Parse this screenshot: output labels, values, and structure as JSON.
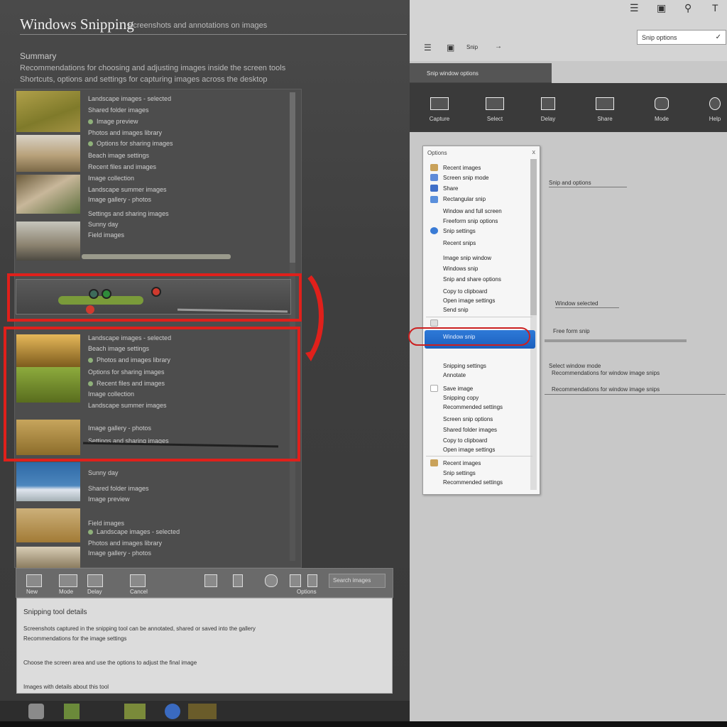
{
  "left": {
    "title": "Windows Snipping",
    "title_rest": "Screenshots and annotations on images",
    "summary_label": "Summary",
    "summary_line_1": "Recommendations for choosing and adjusting images inside the screen tools",
    "summary_line_2": "Shortcuts, options and settings for capturing images across the desktop",
    "rows": [
      "Landscape images - selected",
      "Shared folder images",
      "Image preview",
      "Photos and images library",
      "Options for sharing images",
      "Beach image settings",
      "Recent files and images",
      "Image collection",
      "Landscape summer images",
      "Image gallery - photos",
      "Settings and sharing images",
      "Sunny day",
      "Field images"
    ],
    "toolbar_labels": [
      "New",
      "Mode",
      "Delay",
      "Cancel",
      "Options"
    ],
    "toolbar_search": "Search images",
    "details": {
      "title": "Snipping tool details",
      "lines": [
        "Screenshots captured in the snipping tool can be annotated, shared or saved into the gallery",
        "Recommendations for the image settings",
        "Choose the screen area and use the options to adjust the final image",
        "Images with details about this tool"
      ]
    }
  },
  "right": {
    "dropdown_value": "Snip options",
    "sub_toolbar_label": "Snip",
    "ribbon_header": "Snip window options",
    "ribbon_buttons": [
      "Capture",
      "Select",
      "Delay",
      "Share",
      "Mode",
      "Help"
    ],
    "menu_header": "Options",
    "menu_close": "x",
    "menu_items": [
      "Recent images",
      "Screen snip mode",
      "Share",
      "Rectangular snip",
      "Window and full screen",
      "Freeform snip options",
      "Snip settings",
      "Recent snips",
      "Image snip window",
      "Windows snip",
      "Snip and share options",
      "Copy to clipboard",
      "Open image settings",
      "Send snip",
      "Snipping settings",
      "Annotate",
      "Save image",
      "Snipping copy",
      "Recommended settings",
      "Screen snip options",
      "Shared folder images"
    ],
    "menu_selected": "Window snip",
    "notes": [
      "Snip and options",
      "Window selected",
      "Free form snip",
      "Select window mode",
      "Recommendations for window image snips"
    ]
  },
  "colors": {
    "highlight": "#e0201b",
    "selection": "#1f6ed0"
  }
}
